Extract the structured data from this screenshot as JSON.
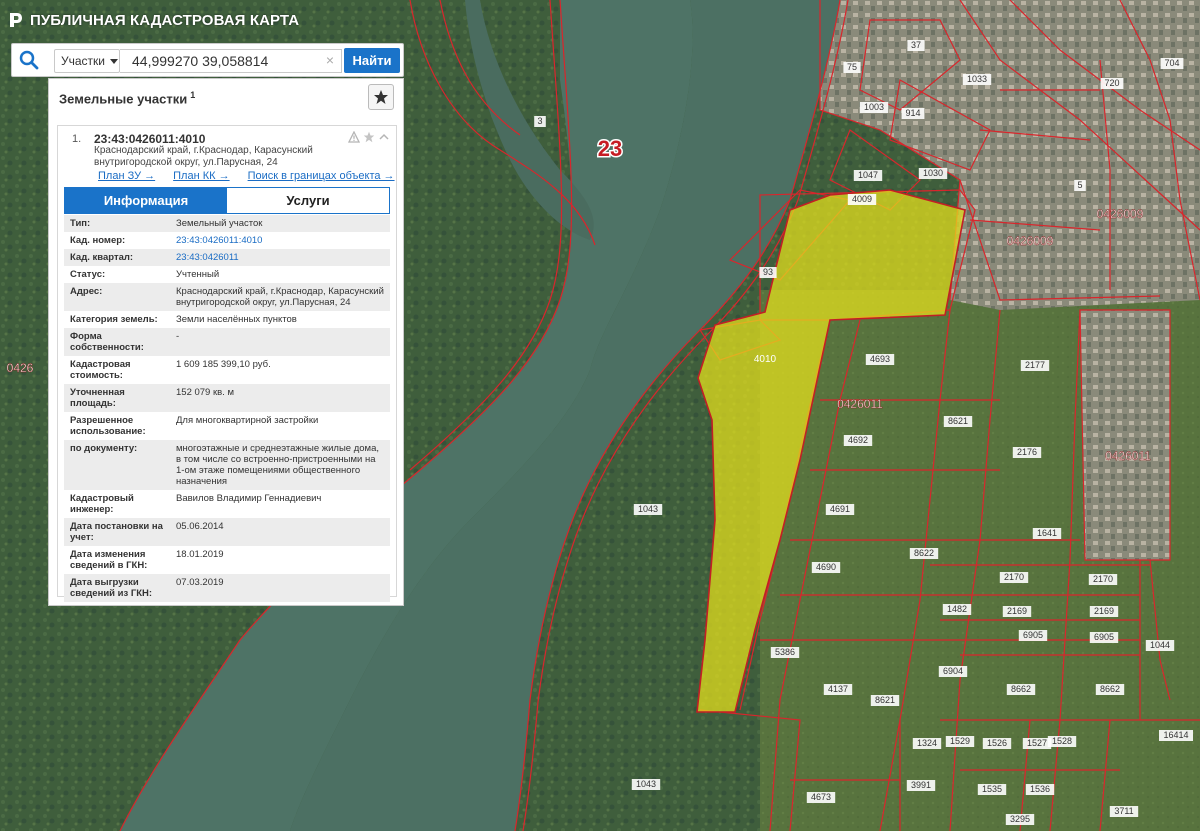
{
  "app": {
    "title": "ПУБЛИЧНАЯ КАДАСТРОВАЯ КАРТА"
  },
  "search": {
    "type_label": "Участки",
    "value": "44,999270 39,058814",
    "clear_symbol": "×",
    "button_label": "Найти"
  },
  "panel": {
    "title": "Земельные участки",
    "count": "1",
    "card": {
      "index": "1.",
      "kad_number": "23:43:0426011:4010",
      "address": "Краснодарский край, г.Краснодар, Карасунский внутригородской округ, ул.Парусная, 24",
      "links": [
        "План ЗУ →",
        "План КК →",
        "Поиск в границах объекта →"
      ],
      "tabs": [
        "Информация",
        "Услуги"
      ],
      "fields": [
        {
          "label": "Тип:",
          "value": "Земельный участок"
        },
        {
          "label": "Кад. номер:",
          "value": "23:43:0426011:4010",
          "link": true
        },
        {
          "label": "Кад. квартал:",
          "value": "23:43:0426011",
          "link": true
        },
        {
          "label": "Статус:",
          "value": "Учтенный"
        },
        {
          "label": "Адрес:",
          "value": "Краснодарский край, г.Краснодар, Карасунский внутригородской округ, ул.Парусная, 24"
        },
        {
          "label": "Категория земель:",
          "value": "Земли населённых пунктов"
        },
        {
          "label": "Форма собственности:",
          "value": "-"
        },
        {
          "label": "Кадастровая стоимость:",
          "value": "1 609 185 399,10 руб."
        },
        {
          "label": "Уточненная площадь:",
          "value": "152 079 кв. м"
        },
        {
          "label": "Разрешенное использование:",
          "value": "Для многоквартирной застройки"
        },
        {
          "label": "по документу:",
          "value": "многоэтажные и среднеэтажные жилые дома, в том числе со встроенно-пристроенными на 1-ом этаже помещениями общественного назначения"
        },
        {
          "label": "Кадастровый инженер:",
          "value": "Вавилов Владимир Геннадиевич"
        },
        {
          "label": "Дата постановки на учет:",
          "value": "05.06.2014"
        },
        {
          "label": "Дата изменения сведений в ГКН:",
          "value": "18.01.2019"
        },
        {
          "label": "Дата выгрузки сведений из ГКН:",
          "value": "07.03.2019"
        }
      ]
    }
  },
  "map": {
    "colors": {
      "parcel_border": "#d9262c",
      "selected_fill": "#e7e21c",
      "water": "#4e7366"
    },
    "region_label": "23",
    "selected_parcel_label": "4010",
    "quarter_labels": [
      "0426011",
      "0426009",
      "0426009",
      "0426011",
      "0426"
    ],
    "parcel_labels": [
      "4693",
      "8621",
      "4692",
      "2177",
      "2176",
      "4691",
      "1641",
      "8622",
      "4690",
      "2170",
      "2170",
      "2169",
      "2169",
      "6905",
      "6905",
      "5386",
      "6904",
      "8662",
      "8662",
      "4137",
      "8621",
      "1043",
      "1043",
      "1030",
      "1047",
      "4009",
      "93",
      "914",
      "1033",
      "37",
      "75",
      "704",
      "720",
      "1324",
      "1526",
      "1527",
      "1528",
      "1529",
      "1535",
      "1536",
      "3991",
      "4673",
      "3295",
      "3711",
      "16414",
      "1482",
      "1044",
      "1003",
      "3",
      "5"
    ]
  }
}
